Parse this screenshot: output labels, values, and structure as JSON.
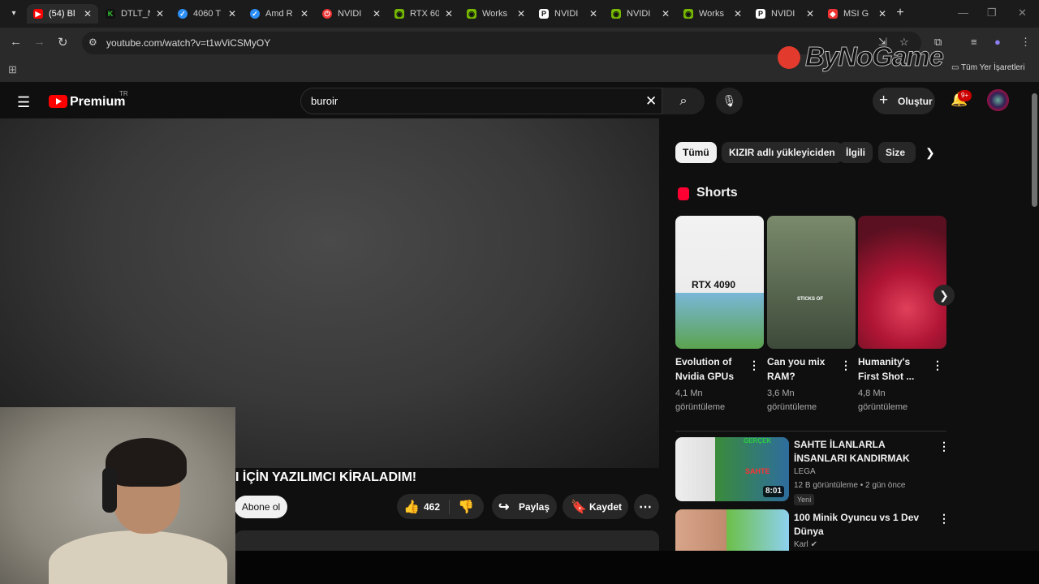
{
  "browser": {
    "tabs": [
      {
        "title": "(54) Bl",
        "icon": "youtube-icon",
        "color": "#ff0000"
      },
      {
        "title": "DTLT_N",
        "icon": "k-icon",
        "color": "#33cc33"
      },
      {
        "title": "4060 T",
        "icon": "check-icon",
        "color": "#2c8ef8"
      },
      {
        "title": "Amd R",
        "icon": "check-icon",
        "color": "#2c8ef8"
      },
      {
        "title": "NVIDI",
        "icon": "power-icon",
        "color": "#e33"
      },
      {
        "title": "RTX 60",
        "icon": "nvidia-icon",
        "color": "#76b900"
      },
      {
        "title": "Works",
        "icon": "nvidia-icon",
        "color": "#76b900"
      },
      {
        "title": "NVIDI",
        "icon": "pc-icon",
        "color": "#ffffff"
      },
      {
        "title": "NVIDI",
        "icon": "nvidia-icon",
        "color": "#76b900"
      },
      {
        "title": "Works",
        "icon": "nvidia-icon",
        "color": "#76b900"
      },
      {
        "title": "NVIDI",
        "icon": "pc-icon",
        "color": "#ffffff"
      },
      {
        "title": "MSI G",
        "icon": "msi-icon",
        "color": "#e33"
      }
    ],
    "url": "youtube.com/watch?v=t1wViCSMyOY",
    "all_bookmarks": "Tüm Yer İşaretleri",
    "watermark": "ByNoGame"
  },
  "youtube": {
    "logo": "Premium",
    "region": "TR",
    "search_value": "buroir",
    "create_label": "Oluştur",
    "notification_count": "9+",
    "video_title": "I İÇİN YAZILIMCI KİRALADIM!",
    "subscribe_label": "Abone ol",
    "like_count": "462",
    "share_label": "Paylaş",
    "save_label": "Kaydet",
    "chips": [
      "Tümü",
      "KIZIR adlı yükleyiciden",
      "İlgili",
      "Size ö"
    ],
    "shorts_header": "Shorts",
    "shorts": [
      {
        "title": "Evolution of Nvidia GPUs",
        "views": "4,1 Mn görüntüleme",
        "thumb_text": "RTX 4090"
      },
      {
        "title": "Can you mix RAM?",
        "views": "3,6 Mn görüntüleme",
        "thumb_text": "STICKS OF"
      },
      {
        "title": "Humanity's First Shot ...",
        "views": "4,8 Mn görüntüleme"
      }
    ],
    "videos": [
      {
        "title": "SAHTE İLANLARLA İNSANLARI KANDIRMAK",
        "channel": "LEGA",
        "meta": "12 B görüntüleme • 2 gün önce",
        "badge": "Yeni",
        "duration": "8:01",
        "thumb_text_1": "GERÇEK",
        "thumb_text_2": "SAHTE"
      },
      {
        "title": "100 Minik Oyuncu vs 1 Dev Dünya",
        "channel": "Karl"
      }
    ]
  }
}
